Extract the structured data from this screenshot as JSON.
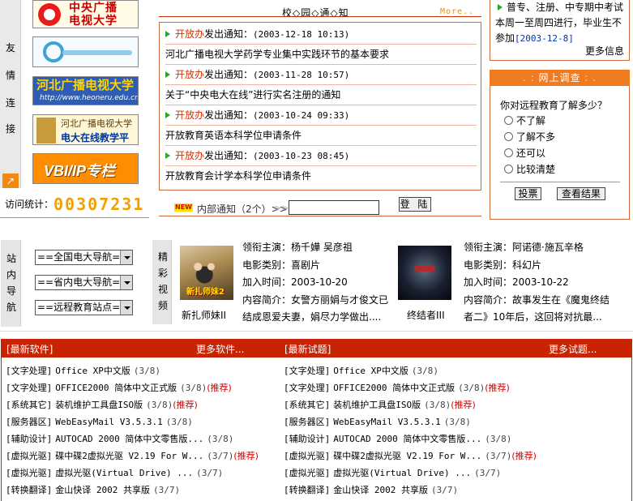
{
  "friends": {
    "label_chars": [
      "友",
      "情",
      "连",
      "接"
    ]
  },
  "logos": {
    "cctv": "中央广播\n电视大学",
    "hebei": "河北广播电视大学",
    "hebei_url": "http://www.heoneru.edu.cn",
    "online_line1": "河北广播电视大学",
    "online_line2": "电大在线教学平台",
    "vbi": "VBI/IP专栏"
  },
  "visit": {
    "label": "访问统计：",
    "count": "00307231"
  },
  "notice": {
    "title": "校◇园◇通◇知",
    "more": "More..",
    "items": [
      {
        "source": "开放办",
        "action": "发出通知：",
        "date": "(2003-12-18 10:13)",
        "title": "河北广播电视大学药学专业集中实践环节的基本要求"
      },
      {
        "source": "开放办",
        "action": "发出通知：",
        "date": "(2003-11-28 10:57)",
        "title": "关于“中央电大在线”进行实名注册的通知"
      },
      {
        "source": "开放办",
        "action": "发出通知：",
        "date": "(2003-10-24 09:33)",
        "title": "开放教育英语本科学位申请条件"
      },
      {
        "source": "开放办",
        "action": "发出通知：",
        "date": "(2003-10-23 08:45)",
        "title": "开放教育会计学本科学位申请条件"
      }
    ],
    "new_badge": "NEW",
    "inner_label": "内部通知（2个）>>",
    "login_label": "登 陆"
  },
  "right_notice": {
    "text": "普专、注册、中专期中考试本周一至周四进行，毕业生不参加",
    "date": "[2003-12-8]",
    "more": "更多信息"
  },
  "survey": {
    "header": "网上调查",
    "question": "你对远程教育了解多少？",
    "options": [
      "不了解",
      "了解不多",
      "还可以",
      "比较清楚"
    ],
    "vote_label": "投票",
    "result_label": "查看结果"
  },
  "station_nav": {
    "label_chars": [
      "站",
      "内",
      "导",
      "航"
    ],
    "selects": [
      "==全国电大导航==",
      "==省内电大导航==",
      "==远程教育站点=="
    ]
  },
  "movies": {
    "label_chars": [
      "精",
      "彩",
      "视",
      "频"
    ],
    "items": [
      {
        "poster_text": "新扎师妹2",
        "cast_label": "领衔主演：",
        "cast": "杨千嬅 吴彦祖",
        "type_label": "电影类别：",
        "type": "喜剧片",
        "time_label": "加入时间：",
        "time": "2003-10-20",
        "desc_label": "内容简介：",
        "desc": "女警方丽娟与才俊文已结成恩爱夫妻，娟尽力学做出....",
        "title": "新扎师妹II"
      },
      {
        "poster_text": "",
        "cast_label": "领衔主演：",
        "cast": "阿诺德·施瓦辛格",
        "type_label": "电影类别：",
        "type": "科幻片",
        "time_label": "加入时间：",
        "time": "2003-10-22",
        "desc_label": "内容简介：",
        "desc": "故事发生在《魔鬼终结者二》10年后，这回将对抗最...",
        "title": "终结者III"
      }
    ]
  },
  "software": {
    "title": "[最新软件]",
    "more": "更多软件...",
    "items": [
      {
        "cat": "[文字处理]",
        "name": "Office XP中文版",
        "count": "(3/8)",
        "rec": ""
      },
      {
        "cat": "[文字处理]",
        "name": "OFFICE2000 简体中文正式版",
        "count": "(3/8)",
        "rec": "(推荐)"
      },
      {
        "cat": "[系统其它]",
        "name": "装机维护工具盘ISO版",
        "count": "(3/8)",
        "rec": "(推荐)"
      },
      {
        "cat": "[服务器区]",
        "name": "WebEasyMail V3.5.3.1",
        "count": "(3/8)",
        "rec": ""
      },
      {
        "cat": "[辅助设计]",
        "name": "AUTOCAD 2000 简体中文零售版...",
        "count": "(3/8)",
        "rec": ""
      },
      {
        "cat": "[虚拟光驱]",
        "name": "碟中碟2虚拟光驱 V2.19 For W...",
        "count": "(3/7)",
        "rec": "(推荐)"
      },
      {
        "cat": "[虚拟光驱]",
        "name": "虚拟光驱(Virtual Drive) ...",
        "count": "(3/7)",
        "rec": ""
      },
      {
        "cat": "[转换翻译]",
        "name": "金山快译 2002 共享版",
        "count": "(3/7)",
        "rec": ""
      }
    ]
  },
  "trial": {
    "title": "[最新试题]",
    "more": "更多试题...",
    "items": [
      {
        "cat": "[文字处理]",
        "name": "Office XP中文版",
        "count": "(3/8)",
        "rec": ""
      },
      {
        "cat": "[文字处理]",
        "name": "OFFICE2000 简体中文正式版",
        "count": "(3/8)",
        "rec": "(推荐)"
      },
      {
        "cat": "[系统其它]",
        "name": "装机维护工具盘ISO版",
        "count": "(3/8)",
        "rec": "(推荐)"
      },
      {
        "cat": "[服务器区]",
        "name": "WebEasyMail V3.5.3.1",
        "count": "(3/8)",
        "rec": ""
      },
      {
        "cat": "[辅助设计]",
        "name": "AUTOCAD 2000 简体中文零售版...",
        "count": "(3/8)",
        "rec": ""
      },
      {
        "cat": "[虚拟光驱]",
        "name": "碟中碟2虚拟光驱 V2.19 For W...",
        "count": "(3/7)",
        "rec": "(推荐)"
      },
      {
        "cat": "[虚拟光驱]",
        "name": "虚拟光驱(Virtual Drive) ...",
        "count": "(3/7)",
        "rec": ""
      },
      {
        "cat": "[转换翻译]",
        "name": "金山快译 2002 共享版",
        "count": "(3/7)",
        "rec": ""
      }
    ]
  }
}
